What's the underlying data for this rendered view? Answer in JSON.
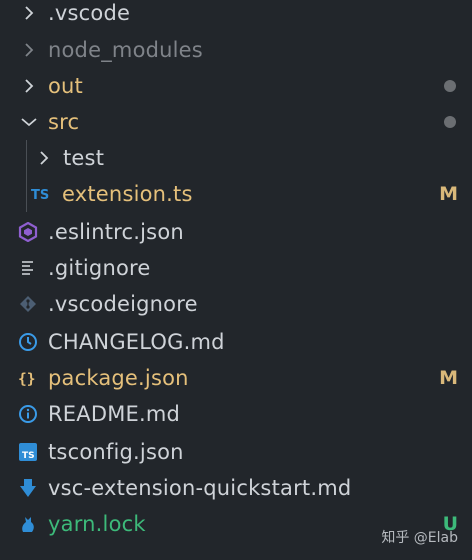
{
  "explorer": {
    "items": [
      {
        "name": ".vscode",
        "kind": "folder",
        "expanded": false,
        "color": "#cfd3d8"
      },
      {
        "name": "node_modules",
        "kind": "folder",
        "expanded": false,
        "color": "#7f8389"
      },
      {
        "name": "out",
        "kind": "folder",
        "expanded": false,
        "color": "#e5c07b",
        "decoration": "dot"
      },
      {
        "name": "src",
        "kind": "folder",
        "expanded": true,
        "color": "#e5c07b",
        "decoration": "dot"
      },
      {
        "name": "test",
        "kind": "folder",
        "expanded": false,
        "color": "#cfd3d8",
        "depth": 1
      },
      {
        "name": "extension.ts",
        "kind": "file",
        "icon": "typescript-icon",
        "color": "#e5c07b",
        "badge": "M",
        "depth": 1
      },
      {
        "name": ".eslintrc.json",
        "kind": "file",
        "icon": "eslint-icon",
        "color": "#cfd3d8"
      },
      {
        "name": ".gitignore",
        "kind": "file",
        "icon": "lines-icon",
        "color": "#cfd3d8"
      },
      {
        "name": ".vscodeignore",
        "kind": "file",
        "icon": "git-diamond-icon",
        "color": "#cfd3d8"
      },
      {
        "name": "CHANGELOG.md",
        "kind": "file",
        "icon": "clock-icon",
        "color": "#cfd3d8"
      },
      {
        "name": "package.json",
        "kind": "file",
        "icon": "braces-icon",
        "color": "#e5c07b",
        "badge": "M"
      },
      {
        "name": "README.md",
        "kind": "file",
        "icon": "info-icon",
        "color": "#cfd3d8"
      },
      {
        "name": "tsconfig.json",
        "kind": "file",
        "icon": "ts-box-icon",
        "color": "#cfd3d8"
      },
      {
        "name": "vsc-extension-quickstart.md",
        "kind": "file",
        "icon": "download-arrow-icon",
        "color": "#cfd3d8"
      },
      {
        "name": "yarn.lock",
        "kind": "file",
        "icon": "yarn-cat-icon",
        "color": "#3dba7a",
        "badge": "U"
      }
    ]
  },
  "colors": {
    "background": "#22262b",
    "modified": "#e5c07b",
    "modified_badge": "#d9b87a",
    "untracked": "#3dba7a",
    "muted": "#7f8389",
    "dot": "#6b6e72",
    "ts_blue": "#2f8dd6",
    "eslint_purple": "#8f5fd0",
    "braces_yellow": "#e5c07b",
    "info_blue": "#3a9be8"
  },
  "watermark": {
    "text": "知乎 @Elab"
  }
}
